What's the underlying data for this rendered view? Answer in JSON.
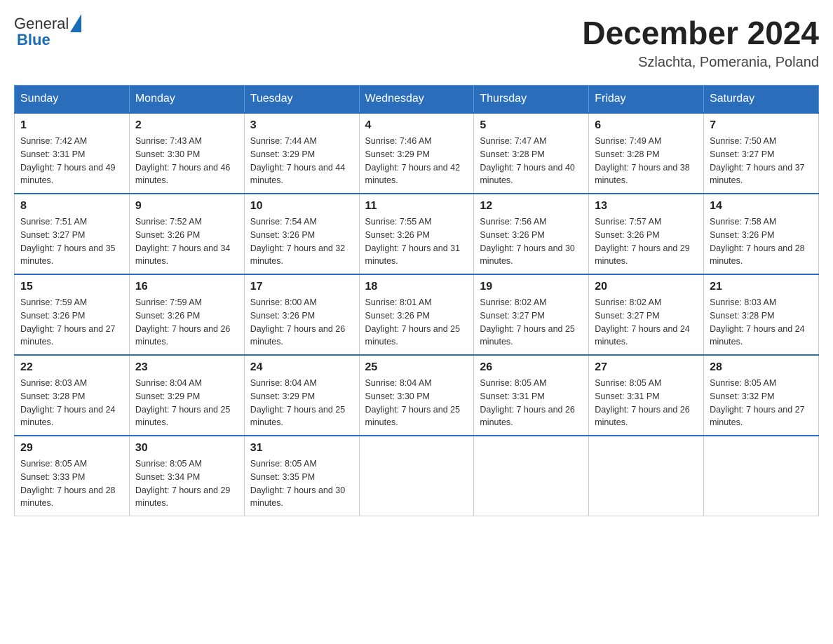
{
  "header": {
    "logo_general": "General",
    "logo_blue": "Blue",
    "month_title": "December 2024",
    "location": "Szlachta, Pomerania, Poland"
  },
  "weekdays": [
    "Sunday",
    "Monday",
    "Tuesday",
    "Wednesday",
    "Thursday",
    "Friday",
    "Saturday"
  ],
  "weeks": [
    [
      {
        "day": "1",
        "sunrise": "7:42 AM",
        "sunset": "3:31 PM",
        "daylight": "7 hours and 49 minutes."
      },
      {
        "day": "2",
        "sunrise": "7:43 AM",
        "sunset": "3:30 PM",
        "daylight": "7 hours and 46 minutes."
      },
      {
        "day": "3",
        "sunrise": "7:44 AM",
        "sunset": "3:29 PM",
        "daylight": "7 hours and 44 minutes."
      },
      {
        "day": "4",
        "sunrise": "7:46 AM",
        "sunset": "3:29 PM",
        "daylight": "7 hours and 42 minutes."
      },
      {
        "day": "5",
        "sunrise": "7:47 AM",
        "sunset": "3:28 PM",
        "daylight": "7 hours and 40 minutes."
      },
      {
        "day": "6",
        "sunrise": "7:49 AM",
        "sunset": "3:28 PM",
        "daylight": "7 hours and 38 minutes."
      },
      {
        "day": "7",
        "sunrise": "7:50 AM",
        "sunset": "3:27 PM",
        "daylight": "7 hours and 37 minutes."
      }
    ],
    [
      {
        "day": "8",
        "sunrise": "7:51 AM",
        "sunset": "3:27 PM",
        "daylight": "7 hours and 35 minutes."
      },
      {
        "day": "9",
        "sunrise": "7:52 AM",
        "sunset": "3:26 PM",
        "daylight": "7 hours and 34 minutes."
      },
      {
        "day": "10",
        "sunrise": "7:54 AM",
        "sunset": "3:26 PM",
        "daylight": "7 hours and 32 minutes."
      },
      {
        "day": "11",
        "sunrise": "7:55 AM",
        "sunset": "3:26 PM",
        "daylight": "7 hours and 31 minutes."
      },
      {
        "day": "12",
        "sunrise": "7:56 AM",
        "sunset": "3:26 PM",
        "daylight": "7 hours and 30 minutes."
      },
      {
        "day": "13",
        "sunrise": "7:57 AM",
        "sunset": "3:26 PM",
        "daylight": "7 hours and 29 minutes."
      },
      {
        "day": "14",
        "sunrise": "7:58 AM",
        "sunset": "3:26 PM",
        "daylight": "7 hours and 28 minutes."
      }
    ],
    [
      {
        "day": "15",
        "sunrise": "7:59 AM",
        "sunset": "3:26 PM",
        "daylight": "7 hours and 27 minutes."
      },
      {
        "day": "16",
        "sunrise": "7:59 AM",
        "sunset": "3:26 PM",
        "daylight": "7 hours and 26 minutes."
      },
      {
        "day": "17",
        "sunrise": "8:00 AM",
        "sunset": "3:26 PM",
        "daylight": "7 hours and 26 minutes."
      },
      {
        "day": "18",
        "sunrise": "8:01 AM",
        "sunset": "3:26 PM",
        "daylight": "7 hours and 25 minutes."
      },
      {
        "day": "19",
        "sunrise": "8:02 AM",
        "sunset": "3:27 PM",
        "daylight": "7 hours and 25 minutes."
      },
      {
        "day": "20",
        "sunrise": "8:02 AM",
        "sunset": "3:27 PM",
        "daylight": "7 hours and 24 minutes."
      },
      {
        "day": "21",
        "sunrise": "8:03 AM",
        "sunset": "3:28 PM",
        "daylight": "7 hours and 24 minutes."
      }
    ],
    [
      {
        "day": "22",
        "sunrise": "8:03 AM",
        "sunset": "3:28 PM",
        "daylight": "7 hours and 24 minutes."
      },
      {
        "day": "23",
        "sunrise": "8:04 AM",
        "sunset": "3:29 PM",
        "daylight": "7 hours and 25 minutes."
      },
      {
        "day": "24",
        "sunrise": "8:04 AM",
        "sunset": "3:29 PM",
        "daylight": "7 hours and 25 minutes."
      },
      {
        "day": "25",
        "sunrise": "8:04 AM",
        "sunset": "3:30 PM",
        "daylight": "7 hours and 25 minutes."
      },
      {
        "day": "26",
        "sunrise": "8:05 AM",
        "sunset": "3:31 PM",
        "daylight": "7 hours and 26 minutes."
      },
      {
        "day": "27",
        "sunrise": "8:05 AM",
        "sunset": "3:31 PM",
        "daylight": "7 hours and 26 minutes."
      },
      {
        "day": "28",
        "sunrise": "8:05 AM",
        "sunset": "3:32 PM",
        "daylight": "7 hours and 27 minutes."
      }
    ],
    [
      {
        "day": "29",
        "sunrise": "8:05 AM",
        "sunset": "3:33 PM",
        "daylight": "7 hours and 28 minutes."
      },
      {
        "day": "30",
        "sunrise": "8:05 AM",
        "sunset": "3:34 PM",
        "daylight": "7 hours and 29 minutes."
      },
      {
        "day": "31",
        "sunrise": "8:05 AM",
        "sunset": "3:35 PM",
        "daylight": "7 hours and 30 minutes."
      },
      null,
      null,
      null,
      null
    ]
  ],
  "labels": {
    "sunrise": "Sunrise: ",
    "sunset": "Sunset: ",
    "daylight": "Daylight: "
  }
}
